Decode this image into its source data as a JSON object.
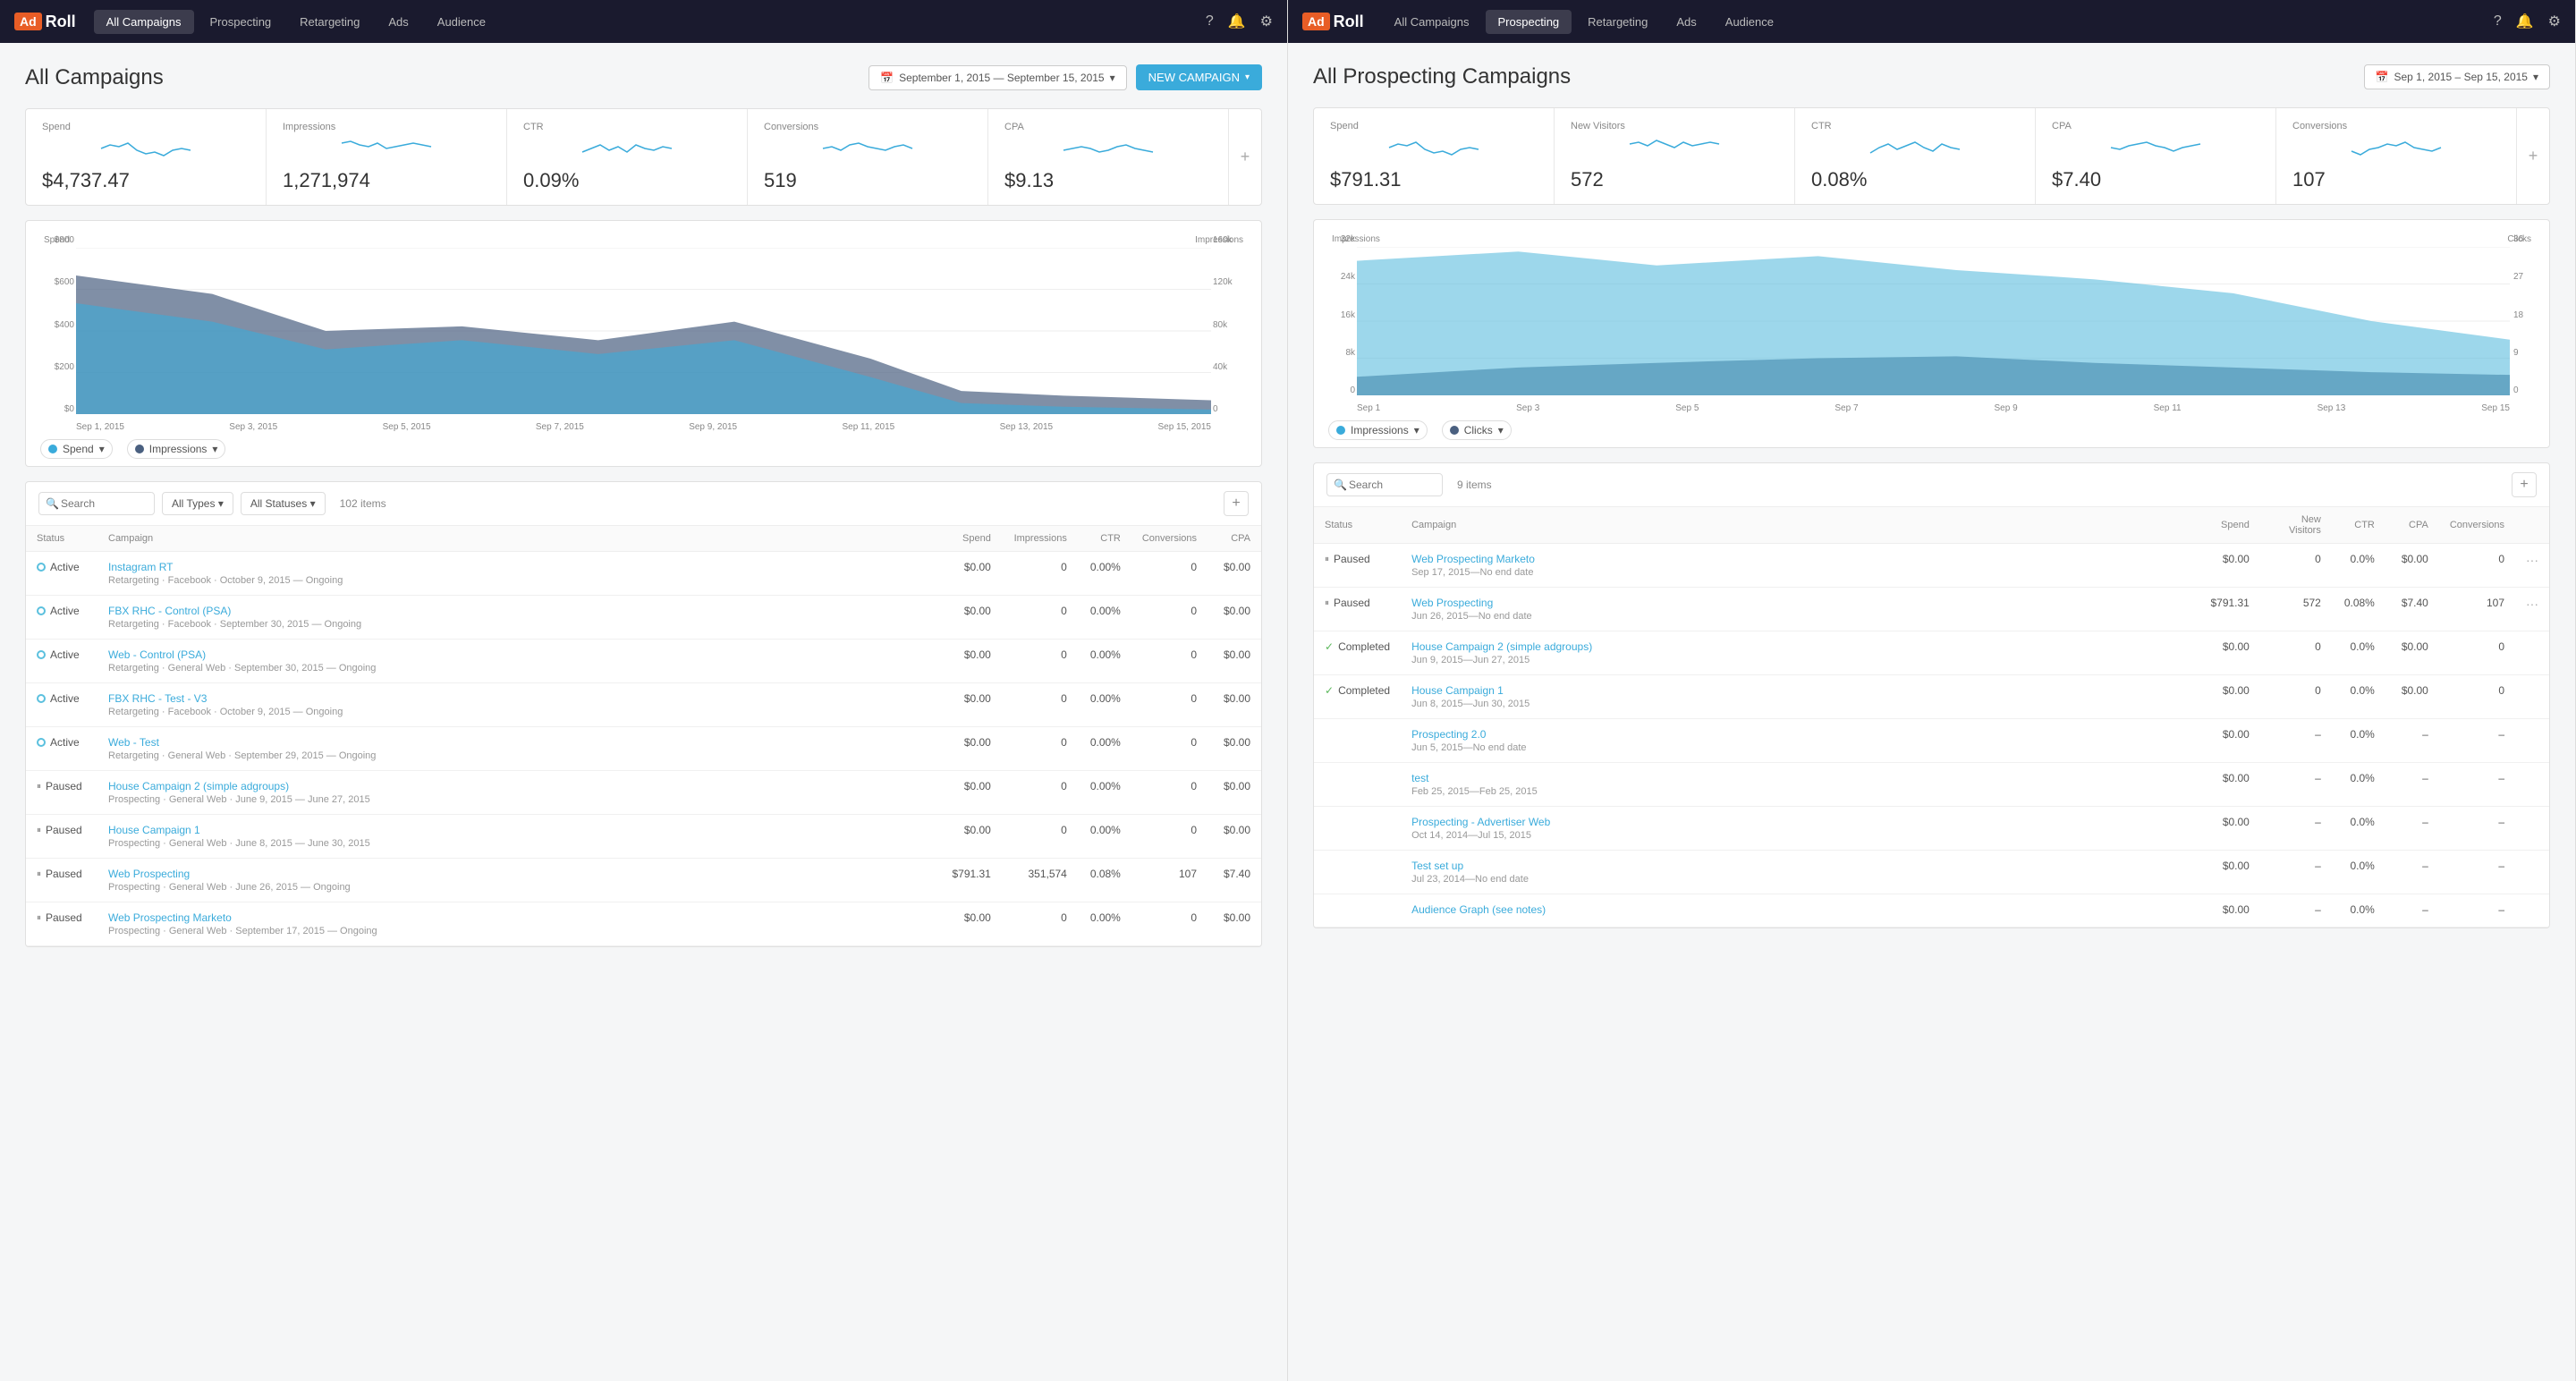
{
  "leftPanel": {
    "nav": {
      "logo": "AdRoll",
      "items": [
        {
          "label": "All Campaigns",
          "active": true
        },
        {
          "label": "Prospecting",
          "active": false
        },
        {
          "label": "Retargeting",
          "active": false
        },
        {
          "label": "Ads",
          "active": false
        },
        {
          "label": "Audience",
          "active": false
        }
      ]
    },
    "header": {
      "title": "All Campaigns",
      "dateRange": "September 1, 2015 — September 15, 2015",
      "newCampaignLabel": "NEW CAMPAIGN"
    },
    "metrics": [
      {
        "label": "Spend",
        "value": "$4,737.47"
      },
      {
        "label": "Impressions",
        "value": "1,271,974"
      },
      {
        "label": "CTR",
        "value": "0.09%"
      },
      {
        "label": "Conversions",
        "value": "519"
      },
      {
        "label": "CPA",
        "value": "$9.13"
      }
    ],
    "chartYLabels": {
      "left": [
        "$800",
        "$600",
        "$400",
        "$200",
        "$0"
      ],
      "leftLabel": "Spend",
      "right": [
        "160k",
        "120k",
        "80k",
        "40k",
        "0"
      ],
      "rightLabel": "Impressions"
    },
    "chartXLabels": [
      "Sep 1, 2015",
      "Sep 3, 2015",
      "Sep 5, 2015",
      "Sep 7, 2015",
      "Sep 9, 2015",
      "Sep 11, 2015",
      "Sep 13, 2015",
      "Sep 15, 2015"
    ],
    "legend": [
      {
        "label": "Spend",
        "color": "blue"
      },
      {
        "label": "Impressions",
        "color": "dark"
      }
    ],
    "table": {
      "searchPlaceholder": "Search",
      "filterType": "All Types",
      "filterStatus": "All Statuses",
      "itemCount": "102 items",
      "columns": [
        "Status",
        "Campaign",
        "Spend",
        "Impressions",
        "CTR",
        "Conversions",
        "CPA"
      ],
      "rows": [
        {
          "status": "Active",
          "statusType": "active",
          "campaign": "Instagram RT",
          "campaignMeta": "Retargeting · Facebook · October 9, 2015 — Ongoing",
          "spend": "$0.00",
          "impressions": "0",
          "ctr": "0.00%",
          "conversions": "0",
          "cpa": "$0.00"
        },
        {
          "status": "Active",
          "statusType": "active",
          "campaign": "FBX RHC - Control (PSA)",
          "campaignMeta": "Retargeting · Facebook · September 30, 2015 — Ongoing",
          "spend": "$0.00",
          "impressions": "0",
          "ctr": "0.00%",
          "conversions": "0",
          "cpa": "$0.00"
        },
        {
          "status": "Active",
          "statusType": "active",
          "campaign": "Web - Control (PSA)",
          "campaignMeta": "Retargeting · General Web · September 30, 2015 — Ongoing",
          "spend": "$0.00",
          "impressions": "0",
          "ctr": "0.00%",
          "conversions": "0",
          "cpa": "$0.00"
        },
        {
          "status": "Active",
          "statusType": "active",
          "campaign": "FBX RHC - Test - V3",
          "campaignMeta": "Retargeting · Facebook · October 9, 2015 — Ongoing",
          "spend": "$0.00",
          "impressions": "0",
          "ctr": "0.00%",
          "conversions": "0",
          "cpa": "$0.00"
        },
        {
          "status": "Active",
          "statusType": "active",
          "campaign": "Web - Test",
          "campaignMeta": "Retargeting · General Web · September 29, 2015 — Ongoing",
          "spend": "$0.00",
          "impressions": "0",
          "ctr": "0.00%",
          "conversions": "0",
          "cpa": "$0.00"
        },
        {
          "status": "Paused",
          "statusType": "paused",
          "campaign": "House Campaign 2 (simple adgroups)",
          "campaignMeta": "Prospecting · General Web · June 9, 2015 — June 27, 2015",
          "spend": "$0.00",
          "impressions": "0",
          "ctr": "0.00%",
          "conversions": "0",
          "cpa": "$0.00"
        },
        {
          "status": "Paused",
          "statusType": "paused",
          "campaign": "House Campaign 1",
          "campaignMeta": "Prospecting · General Web · June 8, 2015 — June 30, 2015",
          "spend": "$0.00",
          "impressions": "0",
          "ctr": "0.00%",
          "conversions": "0",
          "cpa": "$0.00"
        },
        {
          "status": "Paused",
          "statusType": "paused",
          "campaign": "Web Prospecting",
          "campaignMeta": "Prospecting · General Web · June 26, 2015 — Ongoing",
          "spend": "$791.31",
          "impressions": "351,574",
          "ctr": "0.08%",
          "conversions": "107",
          "cpa": "$7.40"
        },
        {
          "status": "Paused",
          "statusType": "paused",
          "campaign": "Web Prospecting Marketo",
          "campaignMeta": "Prospecting · General Web · September 17, 2015 — Ongoing",
          "spend": "$0.00",
          "impressions": "0",
          "ctr": "0.00%",
          "conversions": "0",
          "cpa": "$0.00"
        }
      ]
    }
  },
  "rightPanel": {
    "nav": {
      "logo": "AdRoll",
      "items": [
        {
          "label": "All Campaigns",
          "active": false
        },
        {
          "label": "Prospecting",
          "active": true
        },
        {
          "label": "Retargeting",
          "active": false
        },
        {
          "label": "Ads",
          "active": false
        },
        {
          "label": "Audience",
          "active": false
        }
      ]
    },
    "header": {
      "title": "All Prospecting Campaigns",
      "dateRange": "Sep 1, 2015 – Sep 15, 2015"
    },
    "metrics": [
      {
        "label": "Spend",
        "value": "$791.31"
      },
      {
        "label": "New Visitors",
        "value": "572"
      },
      {
        "label": "CTR",
        "value": "0.08%"
      },
      {
        "label": "CPA",
        "value": "$7.40"
      },
      {
        "label": "Conversions",
        "value": "107"
      }
    ],
    "chartYLabels": {
      "left": [
        "32k",
        "24k",
        "16k",
        "8k",
        "0"
      ],
      "leftLabel": "Impressions",
      "right": [
        "36",
        "27",
        "18",
        "9",
        "0"
      ],
      "rightLabel": "Clicks"
    },
    "chartXLabels": [
      "Sep 1",
      "Sep 3",
      "Sep 5",
      "Sep 7",
      "Sep 9",
      "Sep 11",
      "Sep 13",
      "Sep 15"
    ],
    "legend": [
      {
        "label": "Impressions",
        "color": "blue"
      },
      {
        "label": "Clicks",
        "color": "dark"
      }
    ],
    "table": {
      "searchPlaceholder": "Search",
      "itemCount": "9 items",
      "columns": [
        "Status",
        "Campaign",
        "Spend",
        "New Visitors",
        "CTR",
        "CPA",
        "Conversions"
      ],
      "rows": [
        {
          "status": "Paused",
          "statusType": "paused",
          "campaign": "Web Prospecting Marketo",
          "campaignMeta": "Sep 17, 2015—No end date",
          "spend": "$0.00",
          "newVisitors": "0",
          "ctr": "0.0%",
          "cpa": "$0.00",
          "conversions": "0",
          "hasActions": true
        },
        {
          "status": "Paused",
          "statusType": "paused",
          "campaign": "Web Prospecting",
          "campaignMeta": "Jun 26, 2015—No end date",
          "spend": "$791.31",
          "newVisitors": "572",
          "ctr": "0.08%",
          "cpa": "$7.40",
          "conversions": "107",
          "hasActions": true
        },
        {
          "status": "Completed",
          "statusType": "completed",
          "campaign": "House Campaign 2 (simple adgroups)",
          "campaignMeta": "Jun 9, 2015—Jun 27, 2015",
          "spend": "$0.00",
          "newVisitors": "0",
          "ctr": "0.0%",
          "cpa": "$0.00",
          "conversions": "0",
          "hasActions": false
        },
        {
          "status": "Completed",
          "statusType": "completed",
          "campaign": "House Campaign 1",
          "campaignMeta": "Jun 8, 2015—Jun 30, 2015",
          "spend": "$0.00",
          "newVisitors": "0",
          "ctr": "0.0%",
          "cpa": "$0.00",
          "conversions": "0",
          "hasActions": false
        },
        {
          "status": "",
          "statusType": "none",
          "campaign": "Prospecting 2.0",
          "campaignMeta": "Jun 5, 2015—No end date",
          "spend": "$0.00",
          "newVisitors": "–",
          "ctr": "0.0%",
          "cpa": "–",
          "conversions": "–",
          "hasActions": false
        },
        {
          "status": "",
          "statusType": "none",
          "campaign": "test",
          "campaignMeta": "Feb 25, 2015—Feb 25, 2015",
          "spend": "$0.00",
          "newVisitors": "–",
          "ctr": "0.0%",
          "cpa": "–",
          "conversions": "–",
          "hasActions": false
        },
        {
          "status": "",
          "statusType": "none",
          "campaign": "Prospecting - Advertiser Web",
          "campaignMeta": "Oct 14, 2014—Jul 15, 2015",
          "spend": "$0.00",
          "newVisitors": "–",
          "ctr": "0.0%",
          "cpa": "–",
          "conversions": "–",
          "hasActions": false
        },
        {
          "status": "",
          "statusType": "none",
          "campaign": "Test set up",
          "campaignMeta": "Jul 23, 2014—No end date",
          "spend": "$0.00",
          "newVisitors": "–",
          "ctr": "0.0%",
          "cpa": "–",
          "conversions": "–",
          "hasActions": false
        },
        {
          "status": "",
          "statusType": "none",
          "campaign": "Audience Graph (see notes)",
          "campaignMeta": "",
          "spend": "$0.00",
          "newVisitors": "–",
          "ctr": "0.0%",
          "cpa": "–",
          "conversions": "–",
          "hasActions": false
        }
      ]
    }
  },
  "icons": {
    "search": "🔍",
    "calendar": "📅",
    "plus": "+",
    "chevron_down": "▾",
    "help": "?",
    "bell": "🔔",
    "settings": "⚙"
  }
}
